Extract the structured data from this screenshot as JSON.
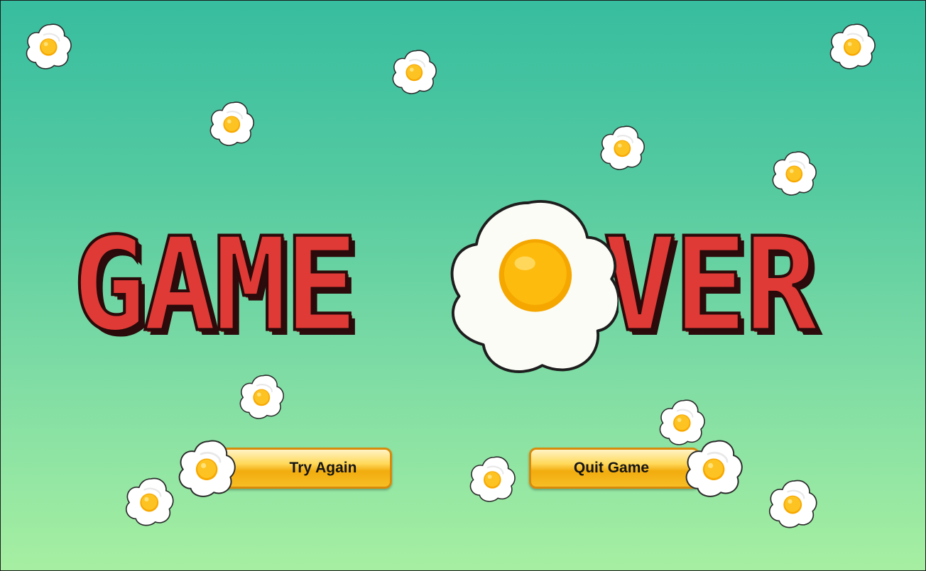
{
  "title": {
    "word1": "GAME",
    "word2": "VER"
  },
  "buttons": {
    "try_again": "Try Again",
    "quit_game": "Quit Game"
  },
  "icons": {
    "big_egg": "fried-egg-icon",
    "small_egg": "fried-egg-icon"
  },
  "colors": {
    "background_top": "#37bd9f",
    "background_bottom": "#a6efa2",
    "title_fill": "#e03a36",
    "title_outline": "#2a0a0a",
    "egg_white": "#ffffff",
    "egg_yolk": "#fdb70a",
    "button_fill": "#f7be25",
    "button_border": "#d88a0a"
  }
}
